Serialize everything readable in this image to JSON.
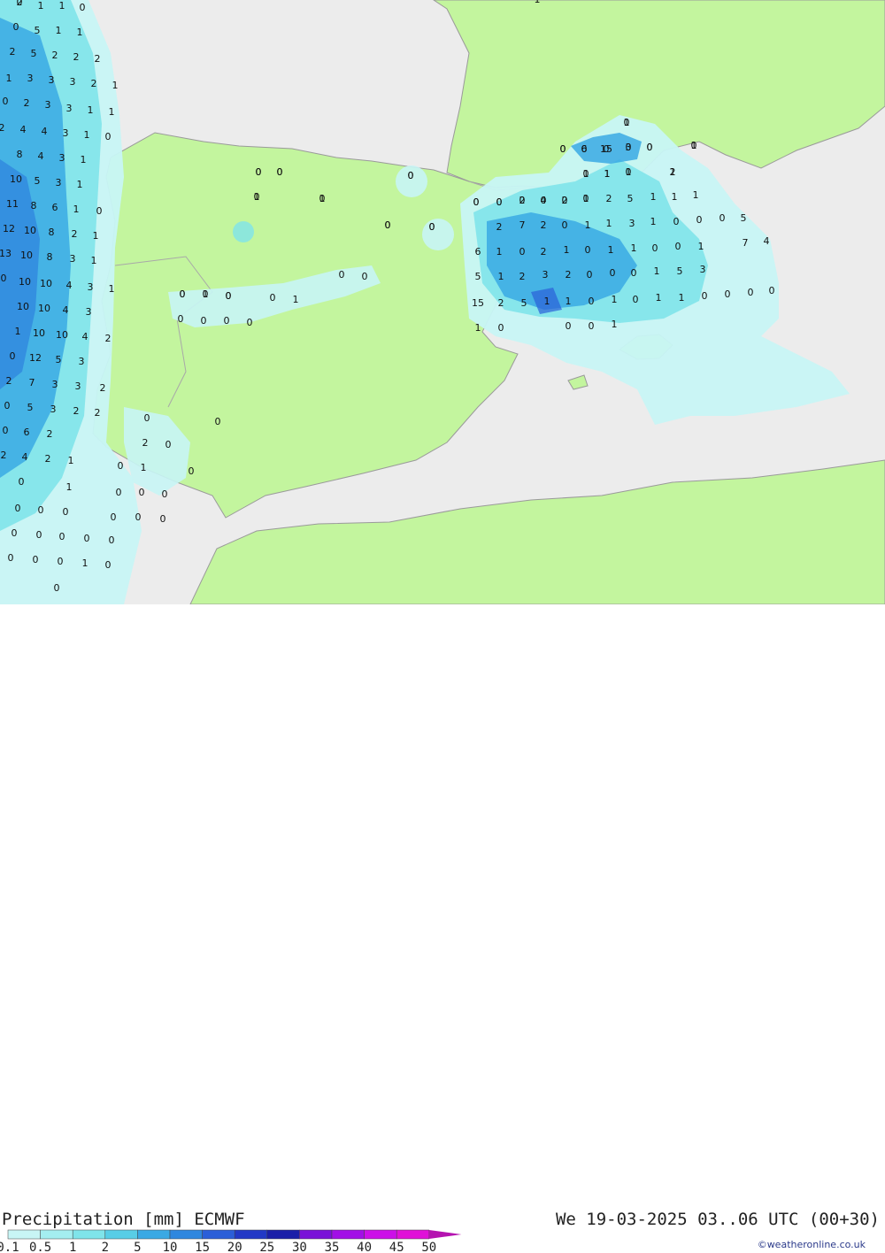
{
  "title": "Precipitation [mm] ECMWF",
  "datetime": "We 19-03-2025 03..06 UTC (00+30)",
  "credit": "©weatheronline.co.uk",
  "legend": {
    "labels": [
      "0.1",
      "0.5",
      "1",
      "2",
      "5",
      "10",
      "15",
      "20",
      "25",
      "30",
      "35",
      "40",
      "45",
      "50"
    ],
    "colors": [
      "#c8f5f5",
      "#a4eef0",
      "#7fe4ea",
      "#58cde6",
      "#3aa9e4",
      "#2f87df",
      "#2b5fd8",
      "#2239c6",
      "#1b1fa8",
      "#7a12d8",
      "#a20fe6",
      "#cc0fe8",
      "#e010d8",
      "#b513b0"
    ]
  },
  "map_values": [
    [
      "2",
      "1",
      "1",
      "0",
      "1",
      "0",
      "5",
      "1",
      "1",
      "2",
      "5",
      "2",
      "2",
      "2",
      "1",
      "3",
      "3",
      "3",
      "2",
      "1",
      "0",
      "2",
      "3",
      "3",
      "1",
      "1",
      "2",
      "4",
      "4",
      "3",
      "1",
      "0",
      "8",
      "4",
      "3",
      "1",
      "10",
      "5",
      "3",
      "1",
      "11",
      "8",
      "6",
      "1",
      "0",
      "12",
      "10",
      "8",
      "2",
      "1",
      "13",
      "10",
      "8",
      "3",
      "1",
      "0",
      "10",
      "10",
      "4",
      "3",
      "1",
      "10",
      "10",
      "4",
      "3",
      "1",
      "10",
      "10",
      "4",
      "2",
      "0",
      "12",
      "5",
      "3",
      "2",
      "7",
      "3",
      "3",
      "2",
      "0",
      "5",
      "3",
      "2",
      "2",
      "0",
      "6",
      "2",
      "2",
      "4",
      "2",
      "1",
      "0",
      "1",
      "0",
      "0",
      "0",
      "0",
      "0",
      "0",
      "0",
      "0",
      "0",
      "0",
      "0",
      "1",
      "0",
      "0",
      "0"
    ],
    [
      "0",
      "0",
      "1",
      "0",
      "0",
      "0",
      "0",
      "0",
      "1",
      "0",
      "0",
      "0",
      "0",
      "0",
      "0",
      "1",
      "0",
      "0",
      "0",
      "0",
      "2",
      "0",
      "0",
      "0",
      "1",
      "0",
      "0",
      "0",
      "0",
      "0",
      "0",
      "0",
      "0",
      "0",
      "1",
      "0",
      "0",
      "0",
      "0",
      "0",
      "0"
    ],
    [
      "0",
      "6",
      "15",
      "3",
      "0",
      "1",
      "0",
      "1",
      "1",
      "2",
      "0",
      "0",
      "0",
      "2",
      "4",
      "2",
      "1",
      "2",
      "5",
      "1",
      "1",
      "1",
      "2",
      "7",
      "2",
      "0",
      "1",
      "1",
      "3",
      "1",
      "0",
      "0",
      "0",
      "5",
      "6",
      "1",
      "0",
      "2",
      "1",
      "0",
      "1",
      "1",
      "0",
      "0",
      "1",
      "7",
      "4",
      "5",
      "1",
      "2",
      "3",
      "2",
      "0",
      "0",
      "0",
      "1",
      "5",
      "3",
      "15",
      "2",
      "5",
      "1",
      "1",
      "0",
      "1",
      "0",
      "1",
      "1",
      "0",
      "0",
      "0",
      "0",
      "1",
      "0",
      "0",
      "0",
      "1",
      "0",
      "0",
      "0",
      "0",
      "0",
      "0",
      "1",
      "1",
      "0",
      "1",
      "1",
      "0",
      "0",
      "0",
      "0",
      "0",
      "0"
    ]
  ]
}
